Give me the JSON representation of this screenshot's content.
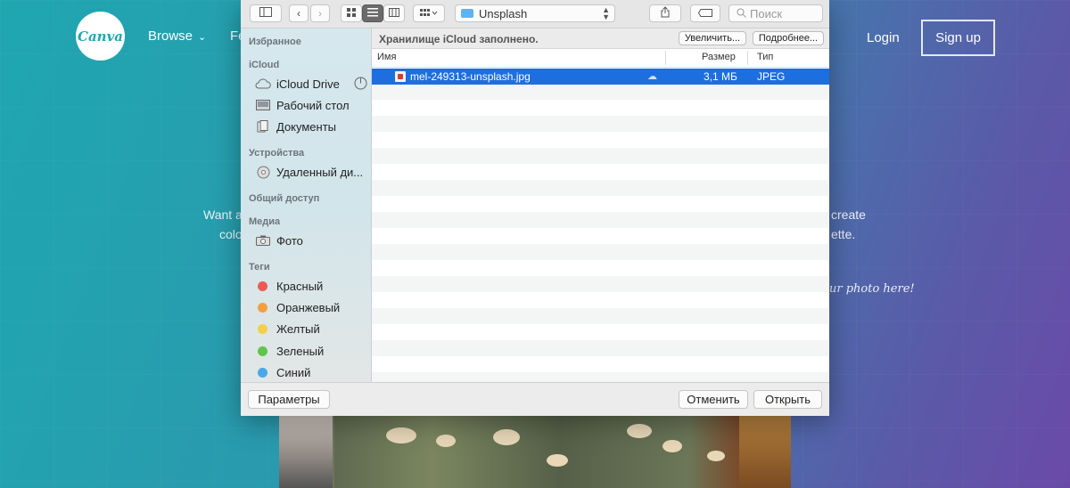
{
  "site": {
    "logo_text": "Canva",
    "nav_browse": "Browse",
    "nav_partial": "Fe",
    "login": "Login",
    "signup": "Sign up",
    "hero_left_1": "Want a",
    "hero_left_2": "colo",
    "hero_right_1": "create",
    "hero_right_2": "ette.",
    "hero_hand": "ur photo here!"
  },
  "dialog": {
    "toolbar": {
      "location": "Unsplash",
      "search_placeholder": "Поиск"
    },
    "sidebar": {
      "favorites_header": "Избранное",
      "icloud_header": "iCloud",
      "icloud_items": [
        {
          "label": "iCloud Drive"
        },
        {
          "label": "Рабочий стол"
        },
        {
          "label": "Документы"
        }
      ],
      "devices_header": "Устройства",
      "devices_items": [
        {
          "label": "Удаленный ди..."
        }
      ],
      "shared_header": "Общий доступ",
      "media_header": "Медиа",
      "media_items": [
        {
          "label": "Фото"
        }
      ],
      "tags_header": "Теги",
      "tags": [
        {
          "label": "Красный",
          "color": "#ec5a58"
        },
        {
          "label": "Оранжевый",
          "color": "#f2a03f"
        },
        {
          "label": "Желтый",
          "color": "#f4cf4a"
        },
        {
          "label": "Зеленый",
          "color": "#5ec64a"
        },
        {
          "label": "Синий",
          "color": "#49a8e8"
        }
      ]
    },
    "banner": {
      "text": "Хранилище iCloud заполнено.",
      "increase_btn": "Увеличить...",
      "more_btn": "Подробнее..."
    },
    "columns": {
      "name": "Имя",
      "size": "Размер",
      "type": "Тип"
    },
    "files": [
      {
        "name": "mel-249313-unsplash.jpg",
        "size": "3,1 МБ",
        "type": "JPEG",
        "selected": true
      }
    ],
    "footer": {
      "options_btn": "Параметры",
      "cancel_btn": "Отменить",
      "open_btn": "Открыть"
    },
    "selection_color": "#1d6fe0"
  }
}
